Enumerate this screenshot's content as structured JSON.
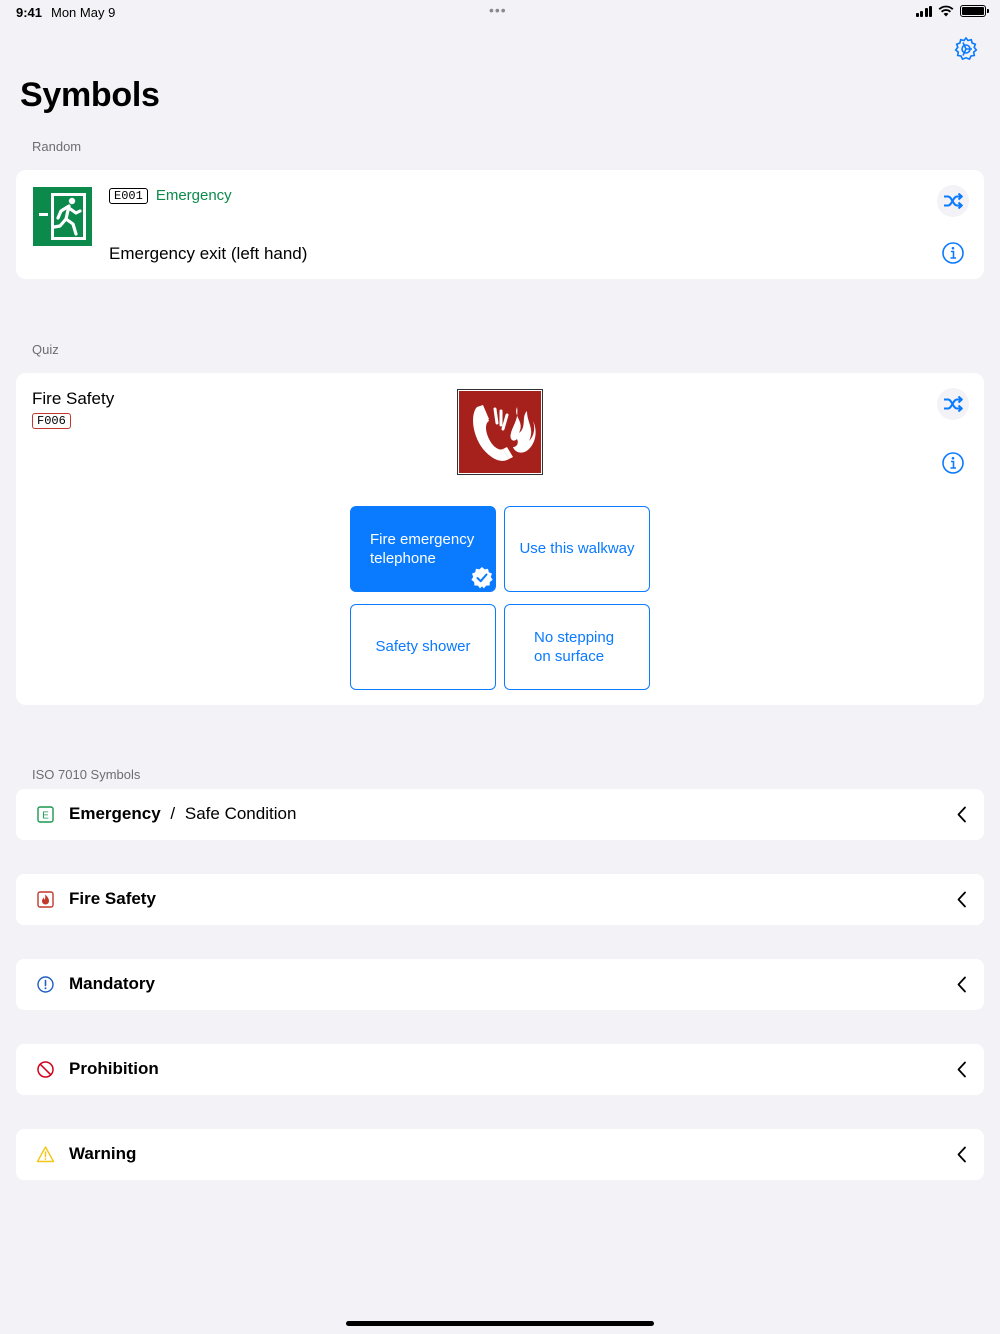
{
  "status": {
    "time": "9:41",
    "date": "Mon May 9",
    "dots": "•••"
  },
  "page": {
    "title": "Symbols"
  },
  "random": {
    "section_label": "Random",
    "code": "E001",
    "category": "Emergency",
    "name": "Emergency exit (left hand)"
  },
  "quiz": {
    "section_label": "Quiz",
    "category": "Fire Safety",
    "code": "F006",
    "answers": [
      {
        "label": "Fire emergency telephone",
        "selected": true
      },
      {
        "label": "Use this walkway",
        "selected": false
      },
      {
        "label": "Safety shower",
        "selected": false
      },
      {
        "label": "No stepping on surface",
        "selected": false
      }
    ]
  },
  "iso": {
    "section_label": "ISO 7010 Symbols",
    "rows": [
      {
        "label": "Emergency",
        "separator": "/",
        "sublabel": "Safe Condition",
        "icon": "emergency-icon",
        "color": "#1a9850"
      },
      {
        "label": "Fire Safety",
        "icon": "fire-safety-icon",
        "color": "#c0392b"
      },
      {
        "label": "Mandatory",
        "icon": "mandatory-icon",
        "color": "#1f5fbf"
      },
      {
        "label": "Prohibition",
        "icon": "prohibition-icon",
        "color": "#d0021b"
      },
      {
        "label": "Warning",
        "icon": "warning-icon",
        "color": "#f5c518"
      }
    ]
  },
  "colors": {
    "accent": "#0a7aff",
    "emergency_green": "#0b8a4c",
    "fire_red": "#a6201c"
  }
}
